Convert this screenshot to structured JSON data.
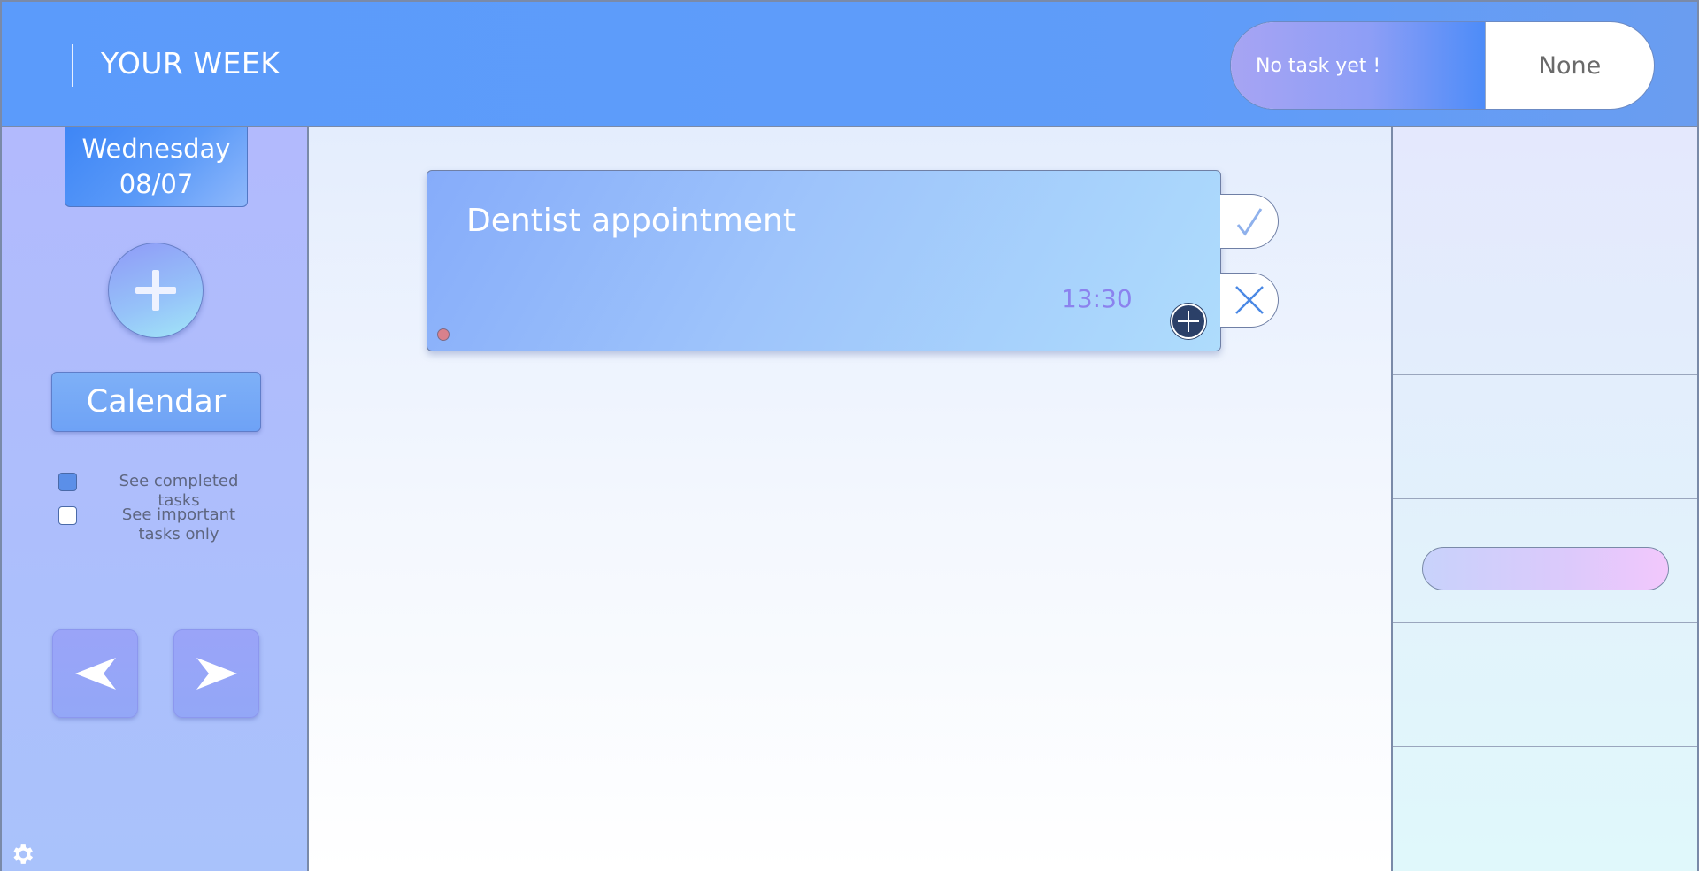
{
  "header": {
    "title": "YOUR WEEK",
    "status_label": "No task yet !",
    "status_value": "None"
  },
  "sidebar": {
    "day_name": "Wednesday",
    "day_date": "08/07",
    "calendar_label": "Calendar",
    "filters": [
      {
        "label": "See completed tasks",
        "checked": true
      },
      {
        "label": "See important tasks only",
        "checked": false
      }
    ],
    "prev_icon": "arrow-left-icon",
    "next_icon": "arrow-right-icon",
    "settings_icon": "gear-icon"
  },
  "tasks": [
    {
      "name": "Dentist appointment",
      "time": "13:30",
      "important_dot_color": "#d9818c"
    }
  ],
  "colors": {
    "header_bg": "#5b9bfb",
    "accent": "#4d8cf8",
    "time_text": "#8b82ee"
  }
}
